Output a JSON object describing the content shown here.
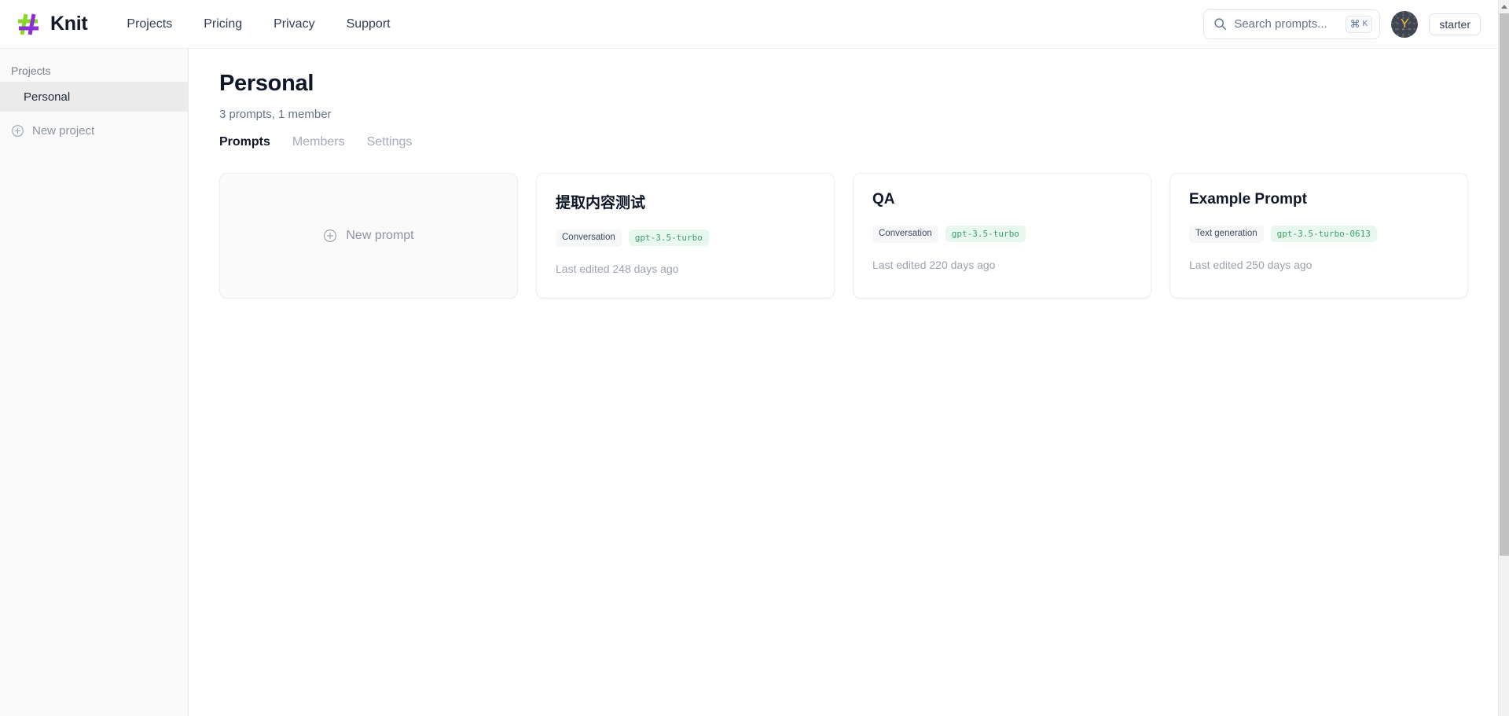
{
  "brand": {
    "name": "Knit",
    "logo_icon": "hash-logo-icon",
    "logo_colors": {
      "green": "#8ad62a",
      "purple": "#8b2fd6"
    }
  },
  "header": {
    "nav": [
      {
        "label": "Projects",
        "name": "nav-projects"
      },
      {
        "label": "Pricing",
        "name": "nav-pricing"
      },
      {
        "label": "Privacy",
        "name": "nav-privacy"
      },
      {
        "label": "Support",
        "name": "nav-support"
      }
    ],
    "search": {
      "placeholder": "Search prompts...",
      "icon": "search-icon",
      "shortcut_cmd": "⌘",
      "shortcut_key": "K"
    },
    "account": {
      "avatar_initial": "Y",
      "avatar_bg": "#3f4450",
      "avatar_fg": "#f0c23d",
      "plan_label": "starter"
    }
  },
  "sidebar": {
    "heading": "Projects",
    "items": [
      {
        "label": "Personal",
        "selected": true
      }
    ],
    "new_project": {
      "label": "New project",
      "icon": "plus-circle-icon"
    }
  },
  "main": {
    "title": "Personal",
    "subtitle": "3 prompts, 1 member",
    "tabs": [
      {
        "label": "Prompts",
        "active": true
      },
      {
        "label": "Members",
        "active": false
      },
      {
        "label": "Settings",
        "active": false
      }
    ],
    "new_prompt": {
      "label": "New prompt",
      "icon": "plus-circle-icon"
    },
    "prompts": [
      {
        "title": "提取内容测试",
        "type_badge": "Conversation",
        "model_badge": "gpt-3.5-turbo",
        "meta": "Last edited 248 days ago"
      },
      {
        "title": "QA",
        "type_badge": "Conversation",
        "model_badge": "gpt-3.5-turbo",
        "meta": "Last edited 220 days ago"
      },
      {
        "title": "Example Prompt",
        "type_badge": "Text generation",
        "model_badge": "gpt-3.5-turbo-0613",
        "meta": "Last edited 250 days ago"
      }
    ]
  },
  "colors": {
    "accent_green": "#3a9f6a",
    "badge_green_bg": "#e8f8ee",
    "sidebar_bg": "#fafafa",
    "selected_bg": "#ebebeb"
  }
}
